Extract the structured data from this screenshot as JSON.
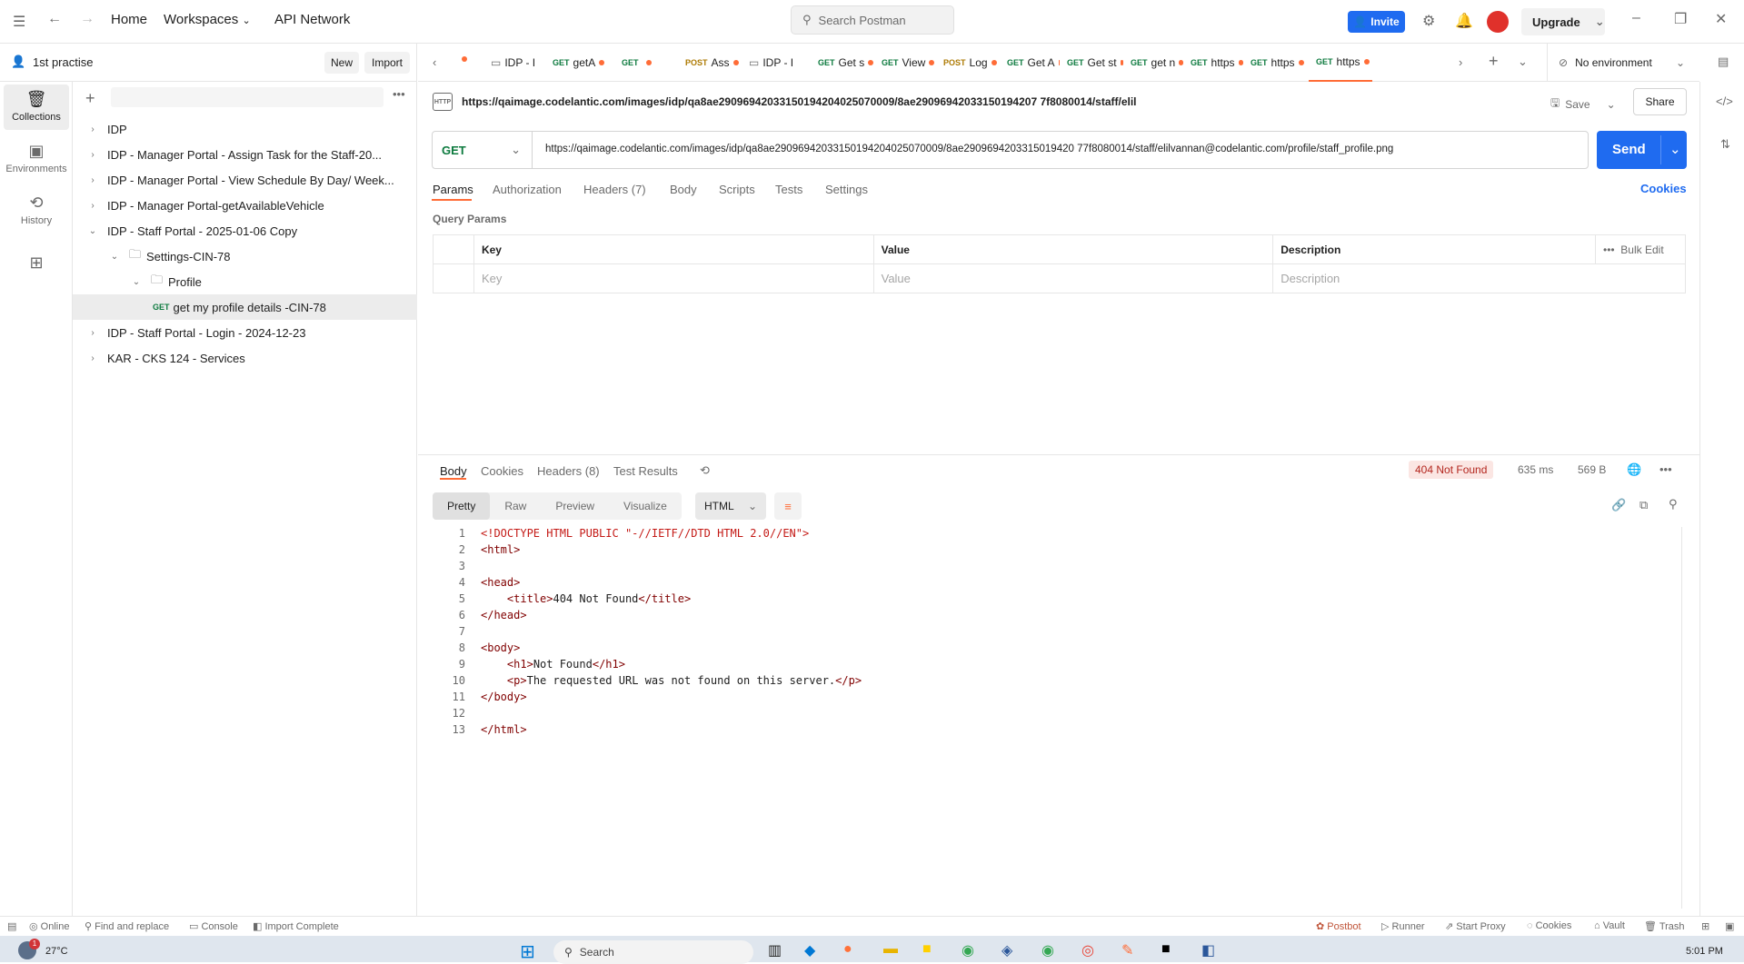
{
  "topbar": {
    "home": "Home",
    "workspaces": "Workspaces",
    "api_network": "API Network",
    "search_placeholder": "Search Postman",
    "invite": "Invite",
    "upgrade": "Upgrade"
  },
  "workspace": {
    "name": "1st practise",
    "new": "New",
    "import": "Import"
  },
  "rail": [
    {
      "label": "Collections"
    },
    {
      "label": "Environments"
    },
    {
      "label": "History"
    }
  ],
  "tree": [
    {
      "label": "IDP",
      "indent": 0,
      "chev": "›",
      "folder": false
    },
    {
      "label": "IDP - Manager Portal - Assign Task for the Staff-20...",
      "indent": 0,
      "chev": "›",
      "folder": false
    },
    {
      "label": "IDP - Manager Portal - View Schedule By Day/ Week...",
      "indent": 0,
      "chev": "›",
      "folder": false
    },
    {
      "label": "IDP - Manager Portal-getAvailableVehicle",
      "indent": 0,
      "chev": "›",
      "folder": false
    },
    {
      "label": "IDP - Staff Portal - 2025-01-06 Copy",
      "indent": 0,
      "chev": "⌄",
      "folder": false
    },
    {
      "label": "Settings-CIN-78",
      "indent": 1,
      "chev": "⌄",
      "folder": true
    },
    {
      "label": "Profile",
      "indent": 2,
      "chev": "⌄",
      "folder": true
    },
    {
      "label": "get my profile details -CIN-78",
      "indent": 3,
      "chev": "",
      "folder": false,
      "method": "GET",
      "selected": true
    },
    {
      "label": "IDP - Staff Portal - Login - 2024-12-23",
      "indent": 0,
      "chev": "›",
      "folder": false
    },
    {
      "label": "KAR - CKS 124 - Services",
      "indent": 0,
      "chev": "›",
      "folder": false
    }
  ],
  "tabs": [
    {
      "method": "",
      "label": "IDP - I"
    },
    {
      "method": "GET",
      "label": "getA"
    },
    {
      "method": "GET",
      "label": ""
    },
    {
      "method": "POST",
      "label": "Ass"
    },
    {
      "method": "",
      "label": "IDP - I"
    },
    {
      "method": "GET",
      "label": "Get s"
    },
    {
      "method": "GET",
      "label": "View"
    },
    {
      "method": "POST",
      "label": "Log"
    },
    {
      "method": "GET",
      "label": "Get A"
    },
    {
      "method": "GET",
      "label": "Get st"
    },
    {
      "method": "GET",
      "label": "get n"
    },
    {
      "method": "GET",
      "label": "https"
    },
    {
      "method": "GET",
      "label": "https"
    },
    {
      "method": "GET",
      "label": "https"
    }
  ],
  "environment": "No environment",
  "request": {
    "title": "https://qaimage.codelantic.com/images/idp/qa8ae2909694203315019420402507000­9/8ae29096942033150194207 7f8080014/staff/elil",
    "save": "Save",
    "share": "Share",
    "method": "GET",
    "url": "https://qaimage.codelantic.com/images/idp/qa8ae29096942033150194204025070009/8ae2909694203315019420 77f8080014/staff/elilvannan@codelantic.com/profile/staff_profile.png",
    "send": "Send",
    "tabs": [
      "Params",
      "Authorization",
      "Headers (7)",
      "Body",
      "Scripts",
      "Tests",
      "Settings"
    ],
    "cookies": "Cookies",
    "query_params": "Query Params",
    "columns": [
      "Key",
      "Value",
      "Description"
    ],
    "bulk_edit": "Bulk Edit",
    "placeholders": [
      "Key",
      "Value",
      "Description"
    ]
  },
  "response": {
    "tabs": [
      "Body",
      "Cookies",
      "Headers (8)",
      "Test Results"
    ],
    "status": "404 Not Found",
    "time": "635 ms",
    "size": "569 B",
    "views": [
      "Pretty",
      "Raw",
      "Preview",
      "Visualize"
    ],
    "format": "HTML",
    "lines": [
      "<!DOCTYPE HTML PUBLIC \"-//IETF//DTD HTML 2.0//EN\">",
      "<html>",
      "",
      "<head>",
      "    <title>404 Not Found</title>",
      "</head>",
      "",
      "<body>",
      "    <h1>Not Found</h1>",
      "    <p>The requested URL was not found on this server.</p>",
      "</body>",
      "",
      "</html>"
    ]
  },
  "statusbar": {
    "online": "Online",
    "find": "Find and replace",
    "console": "Console",
    "import": "Import Complete",
    "postbot": "Postbot",
    "runner": "Runner",
    "proxy": "Start Proxy",
    "cookies": "Cookies",
    "vault": "Vault",
    "trash": "Trash"
  },
  "taskbar": {
    "temp": "27°C",
    "search": "Search",
    "time": "5:01 PM"
  },
  "colors": {
    "accent": "#1f6bf0",
    "orange": "#ff6c37",
    "get": "#0c7a3e",
    "post": "#ad7a03"
  }
}
